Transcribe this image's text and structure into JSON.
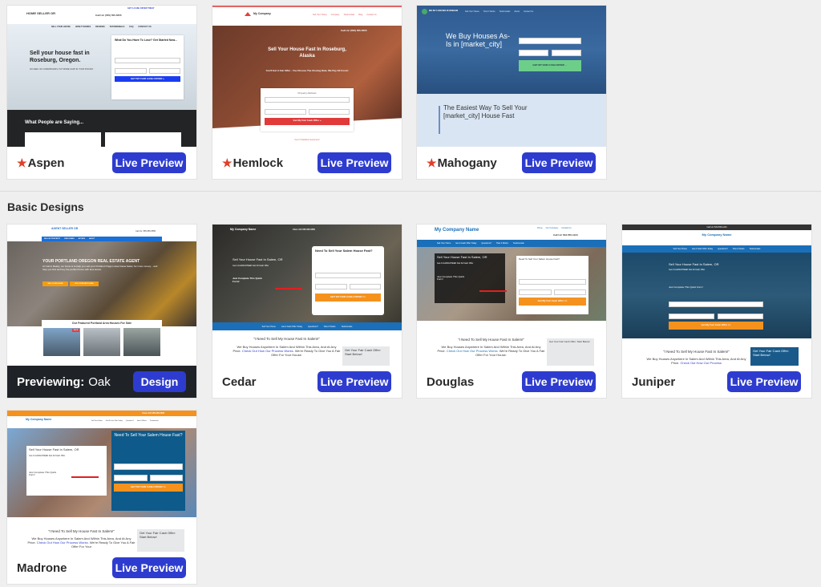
{
  "sections": {
    "basic_title": "Basic Designs"
  },
  "premium_cards": [
    {
      "name": "Aspen",
      "button": "Live Preview",
      "preview": {
        "brand": "HOME SELLER OR",
        "tagline": "Need To Sell Your House Fast? We Buy Houses!",
        "top_links": [
          "GET A CASH OFFER TODAY",
          "OUR COMPANY"
        ],
        "phone": "Call Us! (555) 555-5555",
        "nav": [
          "SELL YOUR HOUSE",
          "HOW IT WORKS",
          "REVIEWS",
          "TESTIMONIALS",
          "FAQ",
          "CONTACT US"
        ],
        "headline": "Sell your house fast in Roseburg, Oregon.",
        "sub": "NO FEES. NO COMMISSIONS. PUT MORE CASH IN YOUR POCKET.",
        "form_title": "What Do You Have To Lose? Get Started Now...",
        "form_labels": [
          "Property Address",
          "Phone",
          "Email"
        ],
        "address_placeholder": "Enter Your Address",
        "cta": "GET MY FAIR CASH OFFER »",
        "testimonials_title": "What People are Saying..."
      }
    },
    {
      "name": "Hemlock",
      "button": "Live Preview",
      "preview": {
        "brand": "My Company",
        "nav": [
          "Sell Your House",
          "Company",
          "Testimonials",
          "Blog",
          "Contact Us"
        ],
        "phone": "Call Us! (555) 555-5555",
        "headline": "Sell Your House Fast In Roseburg, Alaska",
        "sub": "You'll Get A Fair Offer - You Choose The Closing Date. We Pay All Costs!",
        "form_labels": [
          "Property Address",
          "Phone",
          "Email"
        ],
        "address_placeholder": "Enter Your Address",
        "cta": "Get My Fair Cash Offer »",
        "footer_note": "Over 0 Satisfied Customers!"
      }
    },
    {
      "name": "Mahogany",
      "button": "Live Preview",
      "preview": {
        "brand": "WE BUY HOUSES IN OREGON",
        "nav": [
          "Sell Your House",
          "How It Works",
          "Testimonials",
          "About",
          "Contact Us"
        ],
        "headline": "We Buy Houses As-Is in [market_city]",
        "form_labels": [
          "Property Address",
          "Phone",
          "Email"
        ],
        "cta": "GET MY FAIR CASH OFFER →",
        "section_title": "The Easiest Way To Sell Your [market_city] House Fast"
      }
    }
  ],
  "basic_cards": [
    {
      "name": "Oak",
      "previewing_label": "Previewing:",
      "button": "Design",
      "active": true,
      "preview": {
        "brand": "AGENT SELLER OR",
        "phone": "Call Us: 555-555-5555",
        "nav": [
          "SELL MY PROPERTY",
          "FIND HOMES",
          "BUYERS",
          "ABOUT"
        ],
        "headline": "YOUR PORTLAND OREGON REAL ESTATE AGENT",
        "sub": "At Carrot Realty, our focus is to help you sell your Portland Oregon area house faster, for more money... and help you find and buy the perfect home with less stress.",
        "buttons": [
          "SELL YOUR HOUSE",
          "BUY YOUR NEXT HOME"
        ],
        "featured_title": "Our Featured Portland Area Houses For Sale",
        "badge": "SOLD"
      }
    },
    {
      "name": "Cedar",
      "button": "Live Preview",
      "preview": {
        "brand": "My Company Name",
        "phone": "CALL US! 555-555-5555",
        "hero_text": "Sell Your House Fast In Salem, OR",
        "hero_sub": "Get A GUARANTEED Fair All Cash Offer",
        "hero_cta": "Just Complete This Quick Form!",
        "form_title": "Need To Sell Your Salem House Fast?",
        "form_labels": [
          "Property Address",
          "Phone",
          "Email"
        ],
        "cta": "GET MY FAIR CASH OFFER >>",
        "nav": [
          "Sell Your Home",
          "Get A Cash Offer Today",
          "Questions?",
          "How It Works",
          "Testimonials"
        ],
        "quote": "\"I Need To Sell My House Fast In Salem!\"",
        "body": "We Buy Houses Anywhere In Salem And Within This Area, And At Any Price.",
        "body_link": "Check Out How Our Process Works.",
        "body_end": "We're Ready To Give You A Fair Offer For Your House.",
        "side_title": "Get Your Fair Cash Offer: Start Below!"
      }
    },
    {
      "name": "Douglas",
      "button": "Live Preview",
      "preview": {
        "brand": "My Company Name",
        "links": [
          "Home",
          "Our Company",
          "Contact Us"
        ],
        "phone": "Call Us! 503-555-1234",
        "nav": [
          "Sell Your Home",
          "Get A Cash Offer Today",
          "Questions?",
          "How It Works",
          "Testimonials"
        ],
        "hero_text": "Sell Your House Fast In Salem, OR",
        "hero_sub": "Get A GUARANTEED Fair All Cash Offer",
        "hero_cta": "Just Complete This Quick Form!",
        "form_title": "Need To Sell Your Salem House Fast?",
        "form_labels": [
          "Property Address",
          "Phone",
          "Email"
        ],
        "cta": "Get My Fair Cash Offer >>",
        "quote": "\"I Need To Sell My House Fast In Salem!\"",
        "body": "We Buy Houses Anywhere In Salem And Within This Area, And At Any Price.",
        "body_link": "Check Out How Our Process Works.",
        "body_end": "We're Ready To Give You A Fair Offer For Your House.",
        "side_title": "Get Your Fair Cash Offer: Start Below!"
      }
    },
    {
      "name": "Juniper",
      "button": "Live Preview",
      "preview": {
        "topbar": "Call Us! 503-555-1234",
        "brand": "My Company Name",
        "nav": [
          "Sell Your Home",
          "Get A Cash Offer Today",
          "Questions?",
          "How It Works",
          "Testimonials"
        ],
        "hero_text": "Sell Your House Fast In Salem, OR",
        "hero_sub": "Get A GUARANTEED Fair All Cash Offer",
        "hero_cta": "Just Complete This Quick Form!",
        "form_labels": [
          "Property Address",
          "Phone",
          "Email"
        ],
        "cta": "Get My Fair Cash Offer >>",
        "quote": "\"I Need To Sell My House Fast In Salem!\"",
        "body": "We Buy Houses Anywhere In Salem And Within This Area, And At Any Price.",
        "body_link": "Check Out How Our Process",
        "side_title": "Get Your Fair Cash Offer: Start Below!"
      }
    },
    {
      "name": "Madrone",
      "button": "Live Preview",
      "preview": {
        "topbar": "CALL US! 555-555-5555",
        "brand": "My Company Name",
        "nav": [
          "Sell Your Home",
          "Get A Cash Offer Today",
          "Questions?",
          "How It Works",
          "Testimonials"
        ],
        "hero_text": "Sell Your House Fast In Salem, OR",
        "hero_sub": "Get A GUARANTEED Fair All Cash Offer",
        "hero_cta": "Just Complete This Quick Form!",
        "form_title": "Need To Sell Your Salem House Fast?",
        "form_labels": [
          "Property Address",
          "Phone",
          "Email"
        ],
        "cta": "GET MY FAIR CASH OFFER >>",
        "quote": "\"I Need To Sell My House Fast In Salem!\"",
        "body": "We Buy Houses Anywhere In Salem And Within This Area, And At Any Price.",
        "body_link": "Check Out How Our Process Works.",
        "body_end": "We're Ready To Give You A Fair Offer For Your",
        "side_title": "Get Your Fair Cash Offer: Start Below!"
      }
    }
  ],
  "colors": {
    "primary_button": "#2d3ccf",
    "star": "#e0402a",
    "active_footer": "#1f2328",
    "page_bg": "#efefef"
  }
}
